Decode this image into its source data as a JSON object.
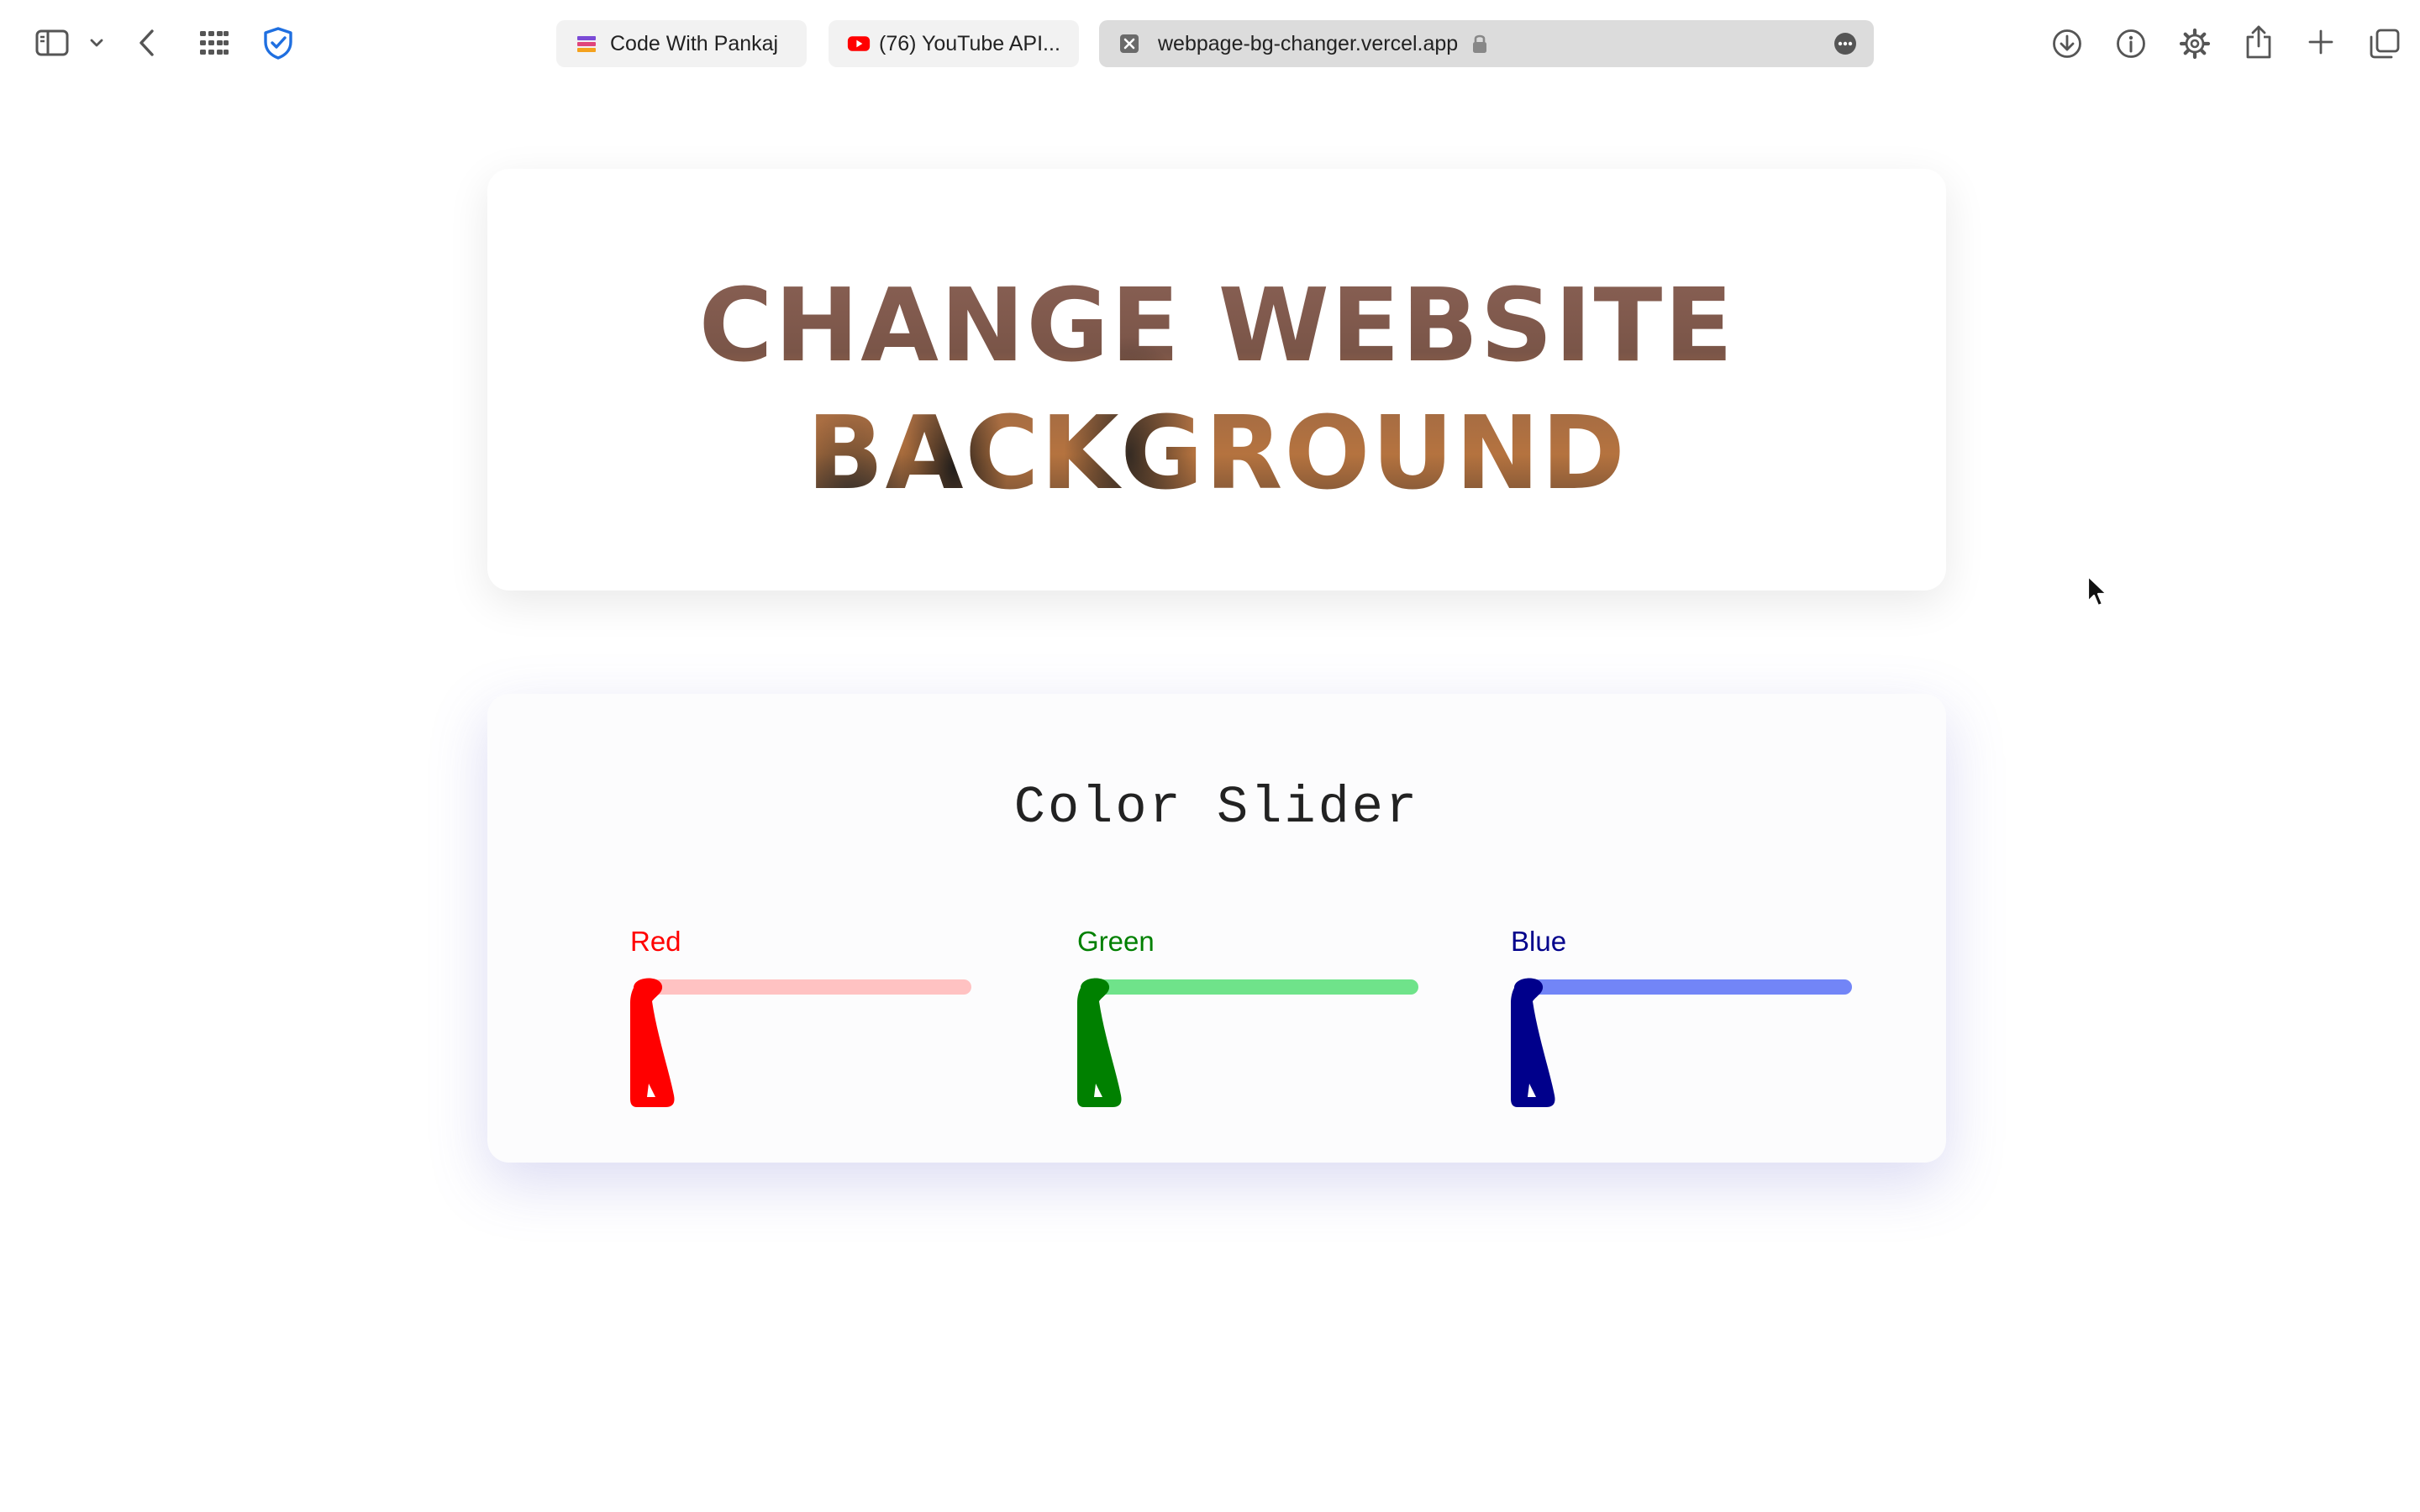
{
  "browser": {
    "tabs": [
      {
        "title": "Code With Pankaj",
        "active": false
      },
      {
        "title": "(76) YouTube API...",
        "active": false
      },
      {
        "title": "webpage-bg-changer.vercel.app",
        "active": true
      }
    ],
    "icons": {
      "sidebar": "sidebar-icon",
      "dropdown": "chevron-down-icon",
      "back": "back-arrow-icon",
      "grid": "grid-icon",
      "shield": "shield-check-icon",
      "download": "download-icon",
      "info": "info-icon",
      "settings": "gear-icon",
      "share": "share-icon",
      "new_tab": "plus-icon",
      "tab_overview": "tabs-overview-icon",
      "more": "more-icon",
      "lock": "lock-icon"
    }
  },
  "hero": {
    "line1": "CHANGE WEBSITE",
    "line2": "BACKGROUND"
  },
  "color_slider": {
    "title": "Color Slider",
    "sliders": [
      {
        "label": "Red",
        "value": 0,
        "color": "#ff0000",
        "track_color": "#ffc2c2"
      },
      {
        "label": "Green",
        "value": 0,
        "color": "#008000",
        "track_color": "#6fe38a"
      },
      {
        "label": "Blue",
        "value": 0,
        "color": "#00008b",
        "track_color": "#7285f7"
      }
    ]
  }
}
